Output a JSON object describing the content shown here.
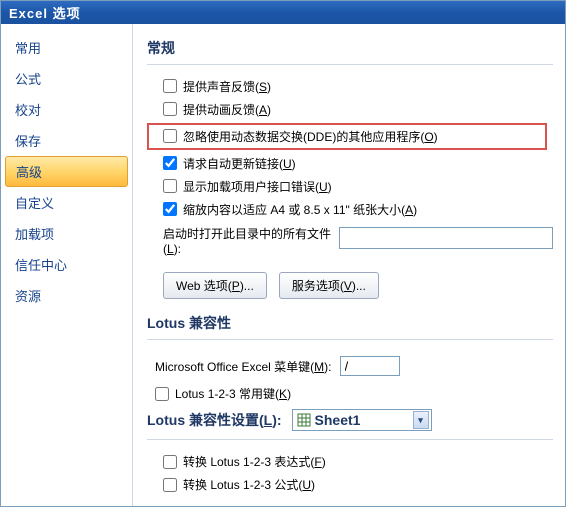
{
  "window": {
    "title": "Excel 选项"
  },
  "sidebar": {
    "items": [
      {
        "label": "常用"
      },
      {
        "label": "公式"
      },
      {
        "label": "校对"
      },
      {
        "label": "保存"
      },
      {
        "label": "高级"
      },
      {
        "label": "自定义"
      },
      {
        "label": "加载项"
      },
      {
        "label": "信任中心"
      },
      {
        "label": "资源"
      }
    ],
    "selected_index": 4
  },
  "general": {
    "title": "常规",
    "sound_feedback": {
      "label": "提供声音反馈(",
      "key": "S",
      "tail": ")",
      "checked": false
    },
    "anim_feedback": {
      "label": "提供动画反馈(",
      "key": "A",
      "tail": ")",
      "checked": false
    },
    "ignore_dde": {
      "label": "忽略使用动态数据交换(DDE)的其他应用程序(",
      "key": "O",
      "tail": ")",
      "checked": false
    },
    "auto_links": {
      "label": "请求自动更新链接(",
      "key": "U",
      "tail": ")",
      "checked": true
    },
    "show_addin_errors": {
      "label": "显示加载项用户接口错误(",
      "key": "U",
      "tail": ")",
      "checked": false
    },
    "scale_a4": {
      "label": "缩放内容以适应 A4 或 8.5 x 11\" 纸张大小(",
      "key": "A",
      "tail": ")",
      "checked": true
    },
    "startup_dir": {
      "label_part1": "启动时打开此目录中的所有文件",
      "label_part2": "(",
      "key": "L",
      "tail": "):",
      "value": ""
    },
    "web_options_btn": {
      "label": "Web 选项(",
      "key": "P",
      "tail": ")..."
    },
    "service_options_btn": {
      "label": "服务选项(",
      "key": "V",
      "tail": ")..."
    }
  },
  "lotus_compat": {
    "title": "Lotus 兼容性",
    "menu_key": {
      "label": "Microsoft Office Excel 菜单键(",
      "key": "M",
      "tail": "):",
      "value": "/"
    },
    "common_keys": {
      "label": "Lotus 1-2-3 常用键(",
      "key": "K",
      "tail": ")",
      "checked": false
    }
  },
  "lotus_settings": {
    "title_label": "Lotus 兼容性设置(",
    "title_key": "L",
    "title_tail": "):",
    "sheet": "Sheet1",
    "convert_expr": {
      "label": "转换 Lotus 1-2-3 表达式(",
      "key": "F",
      "tail": ")",
      "checked": false
    },
    "convert_formula": {
      "label": "转换 Lotus 1-2-3 公式(",
      "key": "U",
      "tail": ")",
      "checked": false
    }
  }
}
